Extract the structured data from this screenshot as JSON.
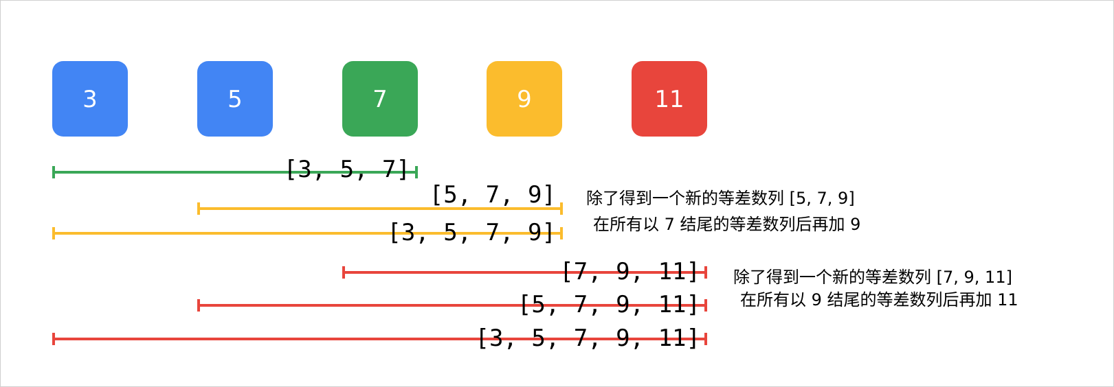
{
  "colors": {
    "blue": "#4285f4",
    "green": "#3aa757",
    "yellow": "#fbbc2d",
    "red": "#e8453c"
  },
  "numbers": [
    {
      "value": "3",
      "color": "blue"
    },
    {
      "value": "5",
      "color": "blue"
    },
    {
      "value": "7",
      "color": "green"
    },
    {
      "value": "9",
      "color": "yellow"
    },
    {
      "value": "11",
      "color": "red"
    }
  ],
  "sequences": [
    {
      "label": "[3, 5, 7]",
      "start": 0,
      "end": 2,
      "color": "green"
    },
    {
      "label": "[5, 7, 9]",
      "start": 1,
      "end": 3,
      "color": "yellow"
    },
    {
      "label": "[3, 5, 7, 9]",
      "start": 0,
      "end": 3,
      "color": "yellow"
    },
    {
      "label": "[7, 9, 11]",
      "start": 2,
      "end": 4,
      "color": "red"
    },
    {
      "label": "[5, 7, 9, 11]",
      "start": 1,
      "end": 4,
      "color": "red"
    },
    {
      "label": "[3, 5, 7, 9, 11]",
      "start": 0,
      "end": 4,
      "color": "red"
    }
  ],
  "notes": [
    {
      "line1": "除了得到一个新的等差数列 [5, 7, 9]",
      "line2": "在所有以 7 结尾的等差数列后再加 9"
    },
    {
      "line1": "除了得到一个新的等差数列 [7, 9, 11]",
      "line2": "在所有以 9 结尾的等差数列后再加 11"
    }
  ]
}
